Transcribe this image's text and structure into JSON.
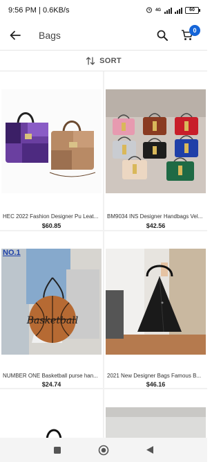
{
  "status": {
    "time": "9:56 PM",
    "speed": "0.6KB/s",
    "network": "4G",
    "battery": "60"
  },
  "app_bar": {
    "title": "Bags",
    "cart_count": "0"
  },
  "sort": {
    "label": "SORT"
  },
  "products": [
    {
      "name": "HEC 2022 Fashion Designer Pu Leat...",
      "price": "$60.85"
    },
    {
      "name": "BM9034 INS Designer Handbags Vel...",
      "price": "$42.56"
    },
    {
      "name": "NUMBER ONE Basketball purse han...",
      "price": "$24.74",
      "image_overlay_text": "NO.1",
      "ball_text": "Basketball"
    },
    {
      "name": "2021 New Designer Bags Famous B...",
      "price": "$46.16"
    }
  ],
  "colors": {
    "badge": "#1565d8",
    "accent": "#333333"
  },
  "icons": [
    "back-arrow-icon",
    "search-icon",
    "cart-icon",
    "sort-arrows-icon",
    "nav-square-icon",
    "nav-circle-icon",
    "nav-triangle-icon"
  ]
}
